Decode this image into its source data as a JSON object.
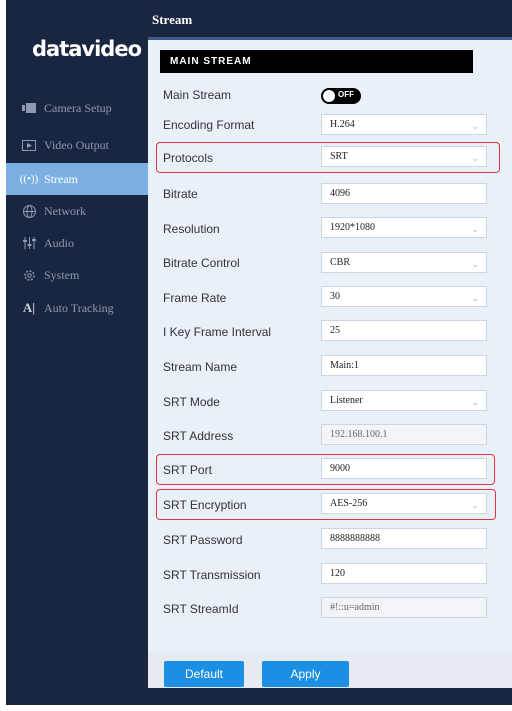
{
  "header": {
    "title": "Stream"
  },
  "brand": {
    "logo": "datavideo"
  },
  "sidebar": {
    "items": [
      {
        "label": "Camera Setup",
        "icon": "camera-icon"
      },
      {
        "label": "Video Output",
        "icon": "video-output-icon"
      },
      {
        "label": "Stream",
        "icon": "stream-icon",
        "active": true
      },
      {
        "label": "Network",
        "icon": "globe-icon"
      },
      {
        "label": "Audio",
        "icon": "audio-sliders-icon"
      },
      {
        "label": "System",
        "icon": "gear-icon"
      },
      {
        "label": "Auto Tracking",
        "icon": "auto-tracking-icon"
      }
    ]
  },
  "section": {
    "title": "MAIN STREAM"
  },
  "form": {
    "main_stream": {
      "label": "Main Stream",
      "toggle": "OFF"
    },
    "encoding_format": {
      "label": "Encoding Format",
      "value": "H.264"
    },
    "protocols": {
      "label": "Protocols",
      "value": "SRT"
    },
    "bitrate": {
      "label": "Bitrate",
      "value": "4096"
    },
    "resolution": {
      "label": "Resolution",
      "value": "1920*1080"
    },
    "bitrate_control": {
      "label": "Bitrate Control",
      "value": "CBR"
    },
    "frame_rate": {
      "label": "Frame Rate",
      "value": "30"
    },
    "i_key_frame_interval": {
      "label": "I Key Frame Interval",
      "value": "25"
    },
    "stream_name": {
      "label": "Stream Name",
      "value": "Main:1"
    },
    "srt_mode": {
      "label": "SRT Mode",
      "value": "Listener"
    },
    "srt_address": {
      "label": "SRT Address",
      "value": "192.168.100.1"
    },
    "srt_port": {
      "label": "SRT Port",
      "value": "9000"
    },
    "srt_encryption": {
      "label": "SRT Encryption",
      "value": "AES-256"
    },
    "srt_password": {
      "label": "SRT Password",
      "value": "8888888888"
    },
    "srt_transmission": {
      "label": "SRT Transmission",
      "value": "120"
    },
    "srt_streamid": {
      "label": "SRT StreamId",
      "value": "#!::u=admin"
    }
  },
  "footer": {
    "default_label": "Default",
    "apply_label": "Apply"
  },
  "colors": {
    "sidebar_bg": "#1a2540",
    "active_nav": "#7cb0e3",
    "button": "#1c8ee3",
    "highlight": "#e0353a"
  }
}
